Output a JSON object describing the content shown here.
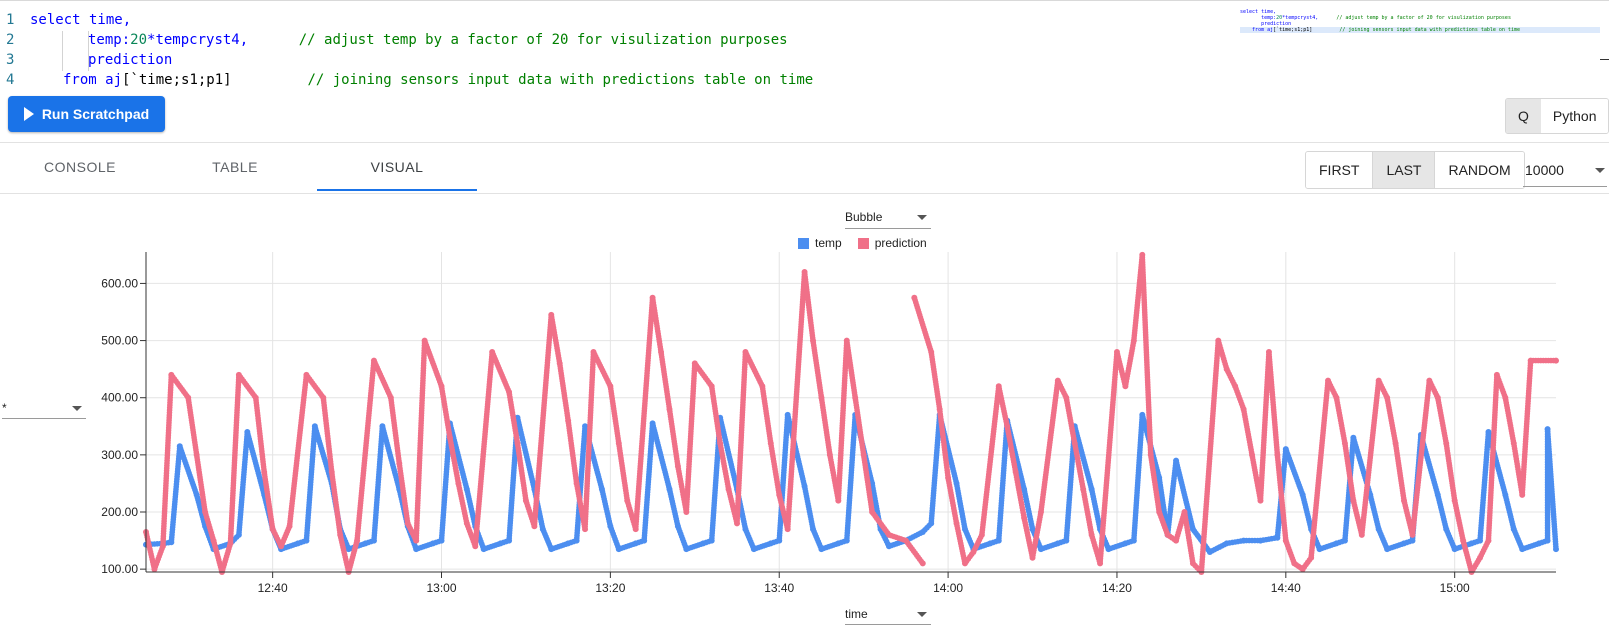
{
  "editor": {
    "lines": [
      {
        "num": "1",
        "tokens": [
          {
            "t": "select time,",
            "c": "kw"
          }
        ]
      },
      {
        "num": "2",
        "tokens": [
          {
            "t": "temp:",
            "c": "kw"
          },
          {
            "t": "20",
            "c": "num"
          },
          {
            "t": "*tempcryst4,",
            "c": "kw"
          },
          {
            "t": "      // adjust temp by a factor of 20 for visulization purposes",
            "c": "cm"
          }
        ]
      },
      {
        "num": "3",
        "tokens": [
          {
            "t": "prediction",
            "c": "kw"
          }
        ]
      },
      {
        "num": "4",
        "tokens": [
          {
            "t": "from aj",
            "c": "kw"
          },
          {
            "t": "[`time;s1;p1]",
            "c": "tx"
          },
          {
            "t": "         // joining sensors input data with predictions table on time",
            "c": "cm"
          }
        ]
      }
    ]
  },
  "toolbar": {
    "run_label": "Run Scratchpad",
    "languages": [
      {
        "label": "Q",
        "active": true
      },
      {
        "label": "Python",
        "active": false
      }
    ]
  },
  "tabs": [
    {
      "label": "CONSOLE",
      "active": false
    },
    {
      "label": "TABLE",
      "active": false
    },
    {
      "label": "VISUAL",
      "active": true
    }
  ],
  "sampling": {
    "options": [
      {
        "label": "FIRST",
        "active": false
      },
      {
        "label": "LAST",
        "active": true
      },
      {
        "label": "RANDOM",
        "active": false
      }
    ],
    "rows": "10000"
  },
  "visual": {
    "chart_type": "Bubble",
    "y_column": "*",
    "x_column": "time"
  },
  "colors": {
    "accent": "#1a73e8",
    "temp": "#4c8ef0",
    "prediction": "#f07088"
  },
  "chart_data": {
    "type": "scatter",
    "legend_position": "top",
    "grid": true,
    "x_ticks": [
      "12:40",
      "13:00",
      "13:20",
      "13:40",
      "14:00",
      "14:20",
      "14:40",
      "15:00"
    ],
    "x_range": [
      "12:25",
      "15:12"
    ],
    "y_ticks": [
      "100.00",
      "200.00",
      "300.00",
      "400.00",
      "500.00",
      "600.00"
    ],
    "ylim": [
      95,
      655
    ],
    "series": [
      {
        "name": "temp",
        "points": [
          [
            "12:25",
            143
          ],
          [
            "12:27",
            145
          ],
          [
            "12:28",
            147
          ],
          [
            "12:29",
            315
          ],
          [
            "12:31",
            230
          ],
          [
            "12:32",
            175
          ],
          [
            "12:33",
            135
          ],
          [
            "12:35",
            145
          ],
          [
            "12:36",
            160
          ],
          [
            "12:37",
            340
          ],
          [
            "12:39",
            230
          ],
          [
            "12:40",
            170
          ],
          [
            "12:41",
            135
          ],
          [
            "12:43",
            145
          ],
          [
            "12:44",
            150
          ],
          [
            "12:45",
            350
          ],
          [
            "12:47",
            250
          ],
          [
            "12:48",
            170
          ],
          [
            "12:49",
            135
          ],
          [
            "12:51",
            145
          ],
          [
            "12:52",
            150
          ],
          [
            "12:53",
            350
          ],
          [
            "12:55",
            240
          ],
          [
            "12:56",
            175
          ],
          [
            "12:57",
            135
          ],
          [
            "12:59",
            145
          ],
          [
            "13:00",
            150
          ],
          [
            "13:01",
            355
          ],
          [
            "13:03",
            240
          ],
          [
            "13:04",
            175
          ],
          [
            "13:05",
            135
          ],
          [
            "13:07",
            145
          ],
          [
            "13:08",
            150
          ],
          [
            "13:09",
            365
          ],
          [
            "13:11",
            240
          ],
          [
            "13:12",
            170
          ],
          [
            "13:13",
            135
          ],
          [
            "13:15",
            145
          ],
          [
            "13:16",
            150
          ],
          [
            "13:17",
            350
          ],
          [
            "13:19",
            240
          ],
          [
            "13:20",
            175
          ],
          [
            "13:21",
            135
          ],
          [
            "13:23",
            145
          ],
          [
            "13:24",
            150
          ],
          [
            "13:25",
            355
          ],
          [
            "13:27",
            240
          ],
          [
            "13:28",
            175
          ],
          [
            "13:29",
            135
          ],
          [
            "13:31",
            145
          ],
          [
            "13:32",
            150
          ],
          [
            "13:33",
            365
          ],
          [
            "13:35",
            240
          ],
          [
            "13:36",
            170
          ],
          [
            "13:37",
            135
          ],
          [
            "13:39",
            145
          ],
          [
            "13:40",
            150
          ],
          [
            "13:41",
            370
          ],
          [
            "13:43",
            245
          ],
          [
            "13:44",
            170
          ],
          [
            "13:45",
            135
          ],
          [
            "13:47",
            145
          ],
          [
            "13:48",
            150
          ],
          [
            "13:49",
            370
          ],
          [
            "13:51",
            250
          ],
          [
            "13:52",
            170
          ],
          [
            "13:53",
            140
          ],
          [
            "13:55",
            150
          ],
          [
            "13:57",
            165
          ],
          [
            "13:58",
            180
          ],
          [
            "13:59",
            370
          ],
          [
            "14:01",
            250
          ],
          [
            "14:02",
            170
          ],
          [
            "14:03",
            135
          ],
          [
            "14:05",
            145
          ],
          [
            "14:06",
            150
          ],
          [
            "14:07",
            360
          ],
          [
            "14:09",
            240
          ],
          [
            "14:10",
            170
          ],
          [
            "14:11",
            135
          ],
          [
            "14:13",
            145
          ],
          [
            "14:14",
            150
          ],
          [
            "14:15",
            350
          ],
          [
            "14:17",
            240
          ],
          [
            "14:18",
            170
          ],
          [
            "14:19",
            135
          ],
          [
            "14:21",
            145
          ],
          [
            "14:22",
            150
          ],
          [
            "14:23",
            370
          ],
          [
            "14:25",
            260
          ],
          [
            "14:26",
            160
          ],
          [
            "14:27",
            290
          ],
          [
            "14:29",
            170
          ],
          [
            "14:31",
            130
          ],
          [
            "14:33",
            145
          ],
          [
            "14:35",
            150
          ],
          [
            "14:37",
            150
          ],
          [
            "14:39",
            155
          ],
          [
            "14:40",
            310
          ],
          [
            "14:42",
            230
          ],
          [
            "14:43",
            170
          ],
          [
            "14:44",
            135
          ],
          [
            "14:46",
            145
          ],
          [
            "14:47",
            150
          ],
          [
            "14:48",
            330
          ],
          [
            "14:50",
            230
          ],
          [
            "14:51",
            170
          ],
          [
            "14:52",
            135
          ],
          [
            "14:54",
            145
          ],
          [
            "14:55",
            150
          ],
          [
            "14:56",
            335
          ],
          [
            "14:58",
            230
          ],
          [
            "14:59",
            170
          ],
          [
            "15:00",
            135
          ],
          [
            "15:02",
            145
          ],
          [
            "15:03",
            150
          ],
          [
            "15:04",
            340
          ],
          [
            "15:06",
            230
          ],
          [
            "15:07",
            170
          ],
          [
            "15:08",
            135
          ],
          [
            "15:10",
            145
          ],
          [
            "15:11",
            150
          ],
          [
            "15:11",
            345
          ],
          [
            "15:12",
            135
          ]
        ]
      },
      {
        "name": "prediction",
        "points": [
          [
            "12:25",
            165
          ],
          [
            "12:26",
            100
          ],
          [
            "12:27",
            140
          ],
          [
            "12:28",
            440
          ],
          [
            "12:30",
            400
          ],
          [
            "12:31",
            300
          ],
          [
            "12:32",
            200
          ],
          [
            "12:33",
            150
          ],
          [
            "12:34",
            80
          ],
          [
            "12:35",
            145
          ],
          [
            "12:36",
            440
          ],
          [
            "12:38",
            400
          ],
          [
            "12:39",
            270
          ],
          [
            "12:40",
            170
          ],
          [
            "12:41",
            140
          ],
          [
            "12:42",
            175
          ],
          [
            "12:44",
            440
          ],
          [
            "12:46",
            400
          ],
          [
            "12:47",
            270
          ],
          [
            "12:48",
            160
          ],
          [
            "12:49",
            95
          ],
          [
            "12:50",
            150
          ],
          [
            "12:52",
            465
          ],
          [
            "12:54",
            400
          ],
          [
            "12:55",
            285
          ],
          [
            "12:56",
            180
          ],
          [
            "12:57",
            150
          ],
          [
            "12:58",
            500
          ],
          [
            "13:00",
            420
          ],
          [
            "13:01",
            330
          ],
          [
            "13:02",
            250
          ],
          [
            "13:03",
            180
          ],
          [
            "13:04",
            140
          ],
          [
            "13:06",
            480
          ],
          [
            "13:08",
            410
          ],
          [
            "13:09",
            320
          ],
          [
            "13:10",
            220
          ],
          [
            "13:11",
            175
          ],
          [
            "13:13",
            545
          ],
          [
            "13:14",
            460
          ],
          [
            "13:15",
            360
          ],
          [
            "13:16",
            250
          ],
          [
            "13:17",
            170
          ],
          [
            "13:18",
            480
          ],
          [
            "13:20",
            420
          ],
          [
            "13:21",
            320
          ],
          [
            "13:22",
            220
          ],
          [
            "13:23",
            170
          ],
          [
            "13:25",
            575
          ],
          [
            "13:26",
            480
          ],
          [
            "13:27",
            380
          ],
          [
            "13:28",
            280
          ],
          [
            "13:29",
            200
          ],
          [
            "13:30",
            460
          ],
          [
            "13:32",
            420
          ],
          [
            "13:33",
            320
          ],
          [
            "13:34",
            240
          ],
          [
            "13:35",
            180
          ],
          [
            "13:36",
            480
          ],
          [
            "13:38",
            420
          ],
          [
            "13:39",
            320
          ],
          [
            "13:40",
            230
          ],
          [
            "13:41",
            170
          ],
          [
            "13:43",
            620
          ],
          [
            "13:44",
            500
          ],
          [
            "13:45",
            400
          ],
          [
            "13:46",
            300
          ],
          [
            "13:47",
            220
          ],
          [
            "13:48",
            500
          ],
          [
            "13:49",
            400
          ],
          [
            "13:50",
            300
          ],
          [
            "13:51",
            200
          ],
          [
            "13:53",
            160
          ],
          [
            "13:55",
            150
          ],
          [
            "13:57",
            110
          ],
          [
            "13:56",
            575
          ],
          [
            "13:58",
            480
          ],
          [
            "13:59",
            380
          ],
          [
            "14:00",
            260
          ],
          [
            "14:01",
            180
          ],
          [
            "14:02",
            110
          ],
          [
            "14:03",
            130
          ],
          [
            "14:04",
            160
          ],
          [
            "14:06",
            420
          ],
          [
            "14:07",
            350
          ],
          [
            "14:08",
            270
          ],
          [
            "14:09",
            190
          ],
          [
            "14:10",
            120
          ],
          [
            "14:11",
            200
          ],
          [
            "14:13",
            430
          ],
          [
            "14:14",
            400
          ],
          [
            "14:15",
            320
          ],
          [
            "14:16",
            240
          ],
          [
            "14:17",
            160
          ],
          [
            "14:18",
            110
          ],
          [
            "14:20",
            480
          ],
          [
            "14:21",
            420
          ],
          [
            "14:22",
            500
          ],
          [
            "14:23",
            650
          ],
          [
            "14:24",
            300
          ],
          [
            "14:25",
            200
          ],
          [
            "14:26",
            160
          ],
          [
            "14:27",
            150
          ],
          [
            "14:28",
            200
          ],
          [
            "14:29",
            110
          ],
          [
            "14:30",
            80
          ],
          [
            "14:32",
            500
          ],
          [
            "14:33",
            450
          ],
          [
            "14:34",
            420
          ],
          [
            "14:35",
            380
          ],
          [
            "14:36",
            300
          ],
          [
            "14:37",
            220
          ],
          [
            "14:38",
            480
          ],
          [
            "14:39",
            300
          ],
          [
            "14:40",
            150
          ],
          [
            "14:41",
            110
          ],
          [
            "14:42",
            100
          ],
          [
            "14:43",
            120
          ],
          [
            "14:45",
            430
          ],
          [
            "14:46",
            400
          ],
          [
            "14:47",
            320
          ],
          [
            "14:48",
            220
          ],
          [
            "14:49",
            160
          ],
          [
            "14:51",
            430
          ],
          [
            "14:52",
            400
          ],
          [
            "14:53",
            320
          ],
          [
            "14:54",
            220
          ],
          [
            "14:55",
            160
          ],
          [
            "14:57",
            430
          ],
          [
            "14:58",
            400
          ],
          [
            "14:59",
            320
          ],
          [
            "15:00",
            220
          ],
          [
            "15:01",
            150
          ],
          [
            "15:02",
            90
          ],
          [
            "15:03",
            120
          ],
          [
            "15:04",
            150
          ],
          [
            "15:05",
            440
          ],
          [
            "15:06",
            400
          ],
          [
            "15:07",
            320
          ],
          [
            "15:08",
            230
          ],
          [
            "15:09",
            465
          ],
          [
            "15:12",
            465
          ]
        ]
      }
    ]
  }
}
